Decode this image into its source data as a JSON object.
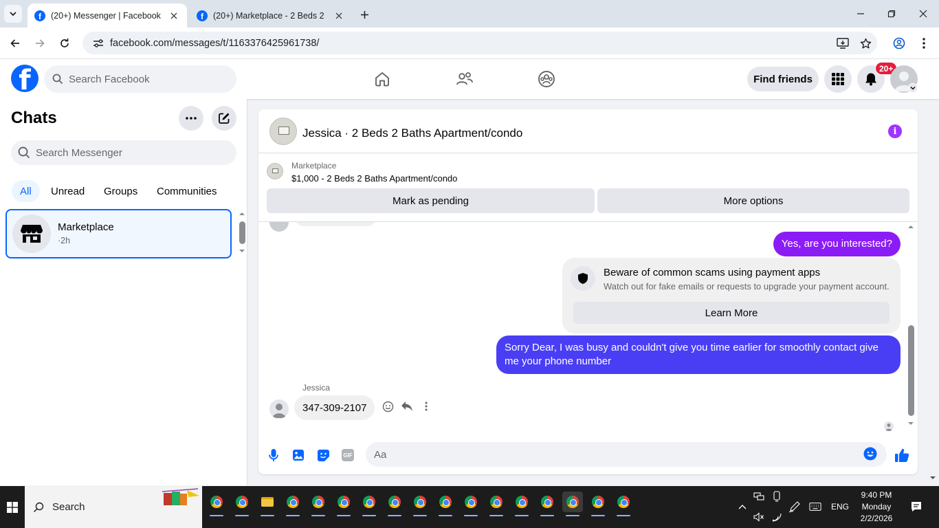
{
  "browser": {
    "tabs": [
      {
        "title": "(20+) Messenger | Facebook",
        "active": true
      },
      {
        "title": "(20+) Marketplace - 2 Beds 2 B",
        "active": false
      }
    ],
    "url": "facebook.com/messages/t/1163376425961738/"
  },
  "header": {
    "search_placeholder": "Search Facebook",
    "find_friends": "Find friends",
    "notification_badge": "20+"
  },
  "chats": {
    "title": "Chats",
    "search_placeholder": "Search Messenger",
    "filters": [
      "All",
      "Unread",
      "Groups",
      "Communities"
    ],
    "items": [
      {
        "name": "Marketplace",
        "time": "·2h"
      }
    ]
  },
  "conversation": {
    "title": "Jessica · 2 Beds 2 Baths Apartment/condo",
    "marketplace_label": "Marketplace",
    "listing": "$1,000 - 2 Beds 2 Baths Apartment/condo",
    "mark_pending": "Mark as pending",
    "more_options": "More options",
    "messages": {
      "out1": "Yes, are you interested?",
      "notice_title": "Beware of common scams using payment apps",
      "notice_sub": "Watch out for fake emails or requests to upgrade your payment account.",
      "notice_btn": "Learn More",
      "out2": "Sorry Dear, I was busy and couldn't give you time earlier for smoothly contact give me your phone number",
      "sender": "Jessica",
      "in1": "347-309-2107"
    },
    "composer_placeholder": "Aa"
  },
  "taskbar": {
    "search": "Search",
    "lang": "ENG",
    "time": "9:40 PM",
    "day": "Monday",
    "date": "2/2/2026"
  },
  "colors": {
    "fb_blue": "#0866ff",
    "messenger_purple": "#a033ff",
    "bubble_blue": "#4a3ef5",
    "bubble_purple": "#8b1cf5"
  }
}
